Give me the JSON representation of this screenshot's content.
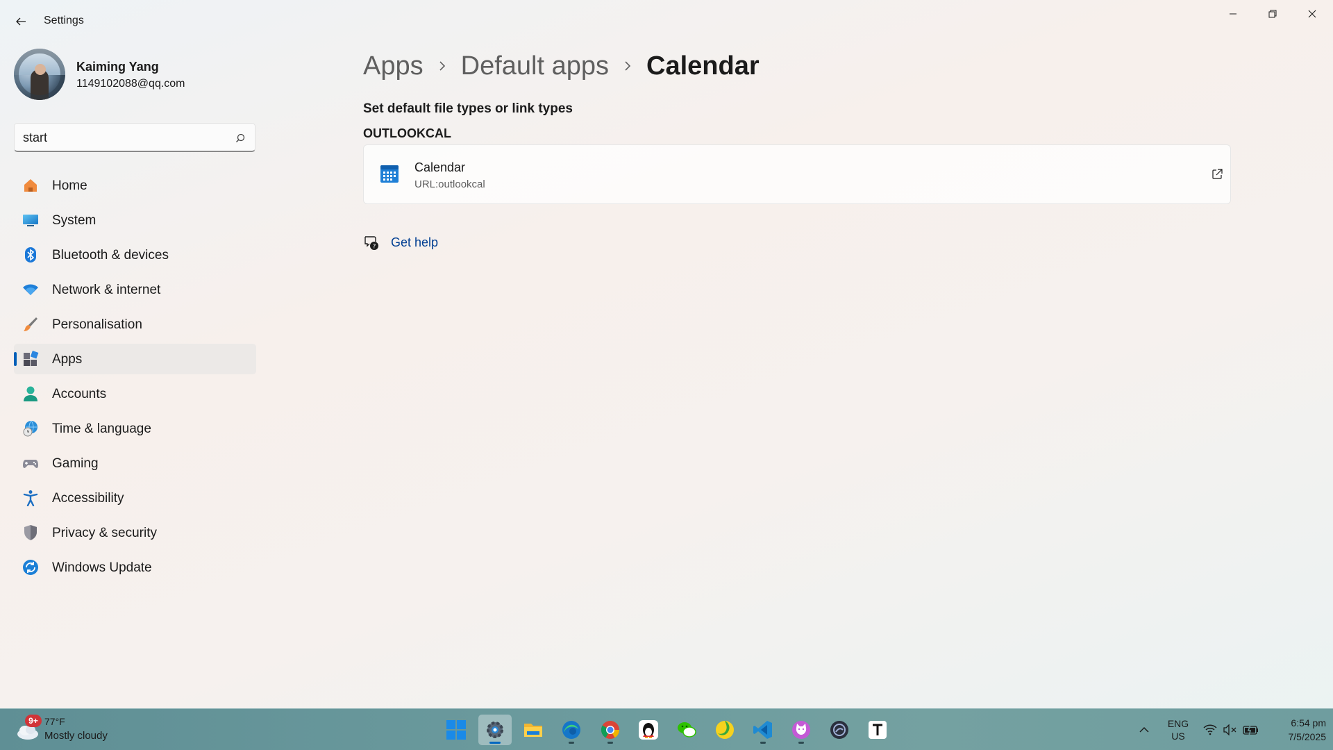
{
  "window": {
    "title": "Settings"
  },
  "profile": {
    "name": "Kaiming Yang",
    "email": "1149102088@qq.com"
  },
  "search": {
    "value": "start",
    "icon": "search-icon"
  },
  "sidebar": {
    "items": [
      {
        "label": "Home",
        "icon": "home-icon",
        "selected": false
      },
      {
        "label": "System",
        "icon": "system-icon",
        "selected": false
      },
      {
        "label": "Bluetooth & devices",
        "icon": "bluetooth-icon",
        "selected": false
      },
      {
        "label": "Network & internet",
        "icon": "wifi-icon",
        "selected": false
      },
      {
        "label": "Personalisation",
        "icon": "brush-icon",
        "selected": false
      },
      {
        "label": "Apps",
        "icon": "apps-icon",
        "selected": true
      },
      {
        "label": "Accounts",
        "icon": "accounts-icon",
        "selected": false
      },
      {
        "label": "Time & language",
        "icon": "globe-clock-icon",
        "selected": false
      },
      {
        "label": "Gaming",
        "icon": "gamepad-icon",
        "selected": false
      },
      {
        "label": "Accessibility",
        "icon": "accessibility-icon",
        "selected": false
      },
      {
        "label": "Privacy & security",
        "icon": "shield-icon",
        "selected": false
      },
      {
        "label": "Windows Update",
        "icon": "update-icon",
        "selected": false
      }
    ]
  },
  "breadcrumb": {
    "items": [
      "Apps",
      "Default apps",
      "Calendar"
    ]
  },
  "main": {
    "section_title": "Set default file types or link types",
    "group_title": "OUTLOOKCAL",
    "card": {
      "name": "Calendar",
      "subtitle": "URL:outlookcal",
      "icon": "calendar-icon"
    },
    "help_label": "Get help"
  },
  "taskbar": {
    "weather": {
      "badge": "9+",
      "temp": "77°F",
      "desc": "Mostly cloudy"
    },
    "apps": [
      "start",
      "settings",
      "file-explorer",
      "edge",
      "chrome",
      "qq",
      "wechat",
      "app-green-yellow",
      "vscode",
      "app-cat",
      "app-dark",
      "typora"
    ],
    "language": {
      "line1": "ENG",
      "line2": "US"
    },
    "clock": {
      "time": "6:54 pm",
      "date": "7/5/2025"
    }
  },
  "colors": {
    "accent": "#005fb8",
    "link": "#003e92"
  }
}
